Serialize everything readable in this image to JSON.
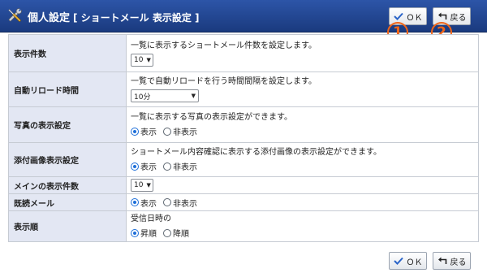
{
  "header": {
    "title": "個人設定",
    "subtitle": "[ ショートメール  表示設定 ]",
    "icon": "tools-icon"
  },
  "buttons": {
    "ok_label": "ＯＫ",
    "back_label": "戻る"
  },
  "markers": {
    "ok_marker": "1",
    "back_marker": "2"
  },
  "settings": {
    "display_count": {
      "label": "表示件数",
      "description": "一覧に表示するショートメール件数を設定します。",
      "value": "10"
    },
    "auto_reload": {
      "label": "自動リロード時間",
      "description": "一覧で自動リロードを行う時間間隔を設定します。",
      "value": "10分"
    },
    "photo_display": {
      "label": "写真の表示設定",
      "description": "一覧に表示する写真の表示設定ができます。",
      "option_show": "表示",
      "option_hide": "非表示",
      "selected": "表示"
    },
    "attachment_display": {
      "label": "添付画像表示設定",
      "description": "ショートメール内容確認に表示する添付画像の表示設定ができます。",
      "option_show": "表示",
      "option_hide": "非表示",
      "selected": "表示"
    },
    "main_display_count": {
      "label": "メインの表示件数",
      "value": "10"
    },
    "read_mail": {
      "label": "既読メール",
      "option_show": "表示",
      "option_hide": "非表示",
      "selected": "表示"
    },
    "display_order": {
      "label": "表示順",
      "description": "受信日時の",
      "option_asc": "昇順",
      "option_desc": "降順",
      "selected": "昇順"
    }
  },
  "colors": {
    "titlebar": "#1f4690",
    "label_bg": "#e3e7f3",
    "marker": "#f06418",
    "radio_selected": "#1e6fd9"
  }
}
